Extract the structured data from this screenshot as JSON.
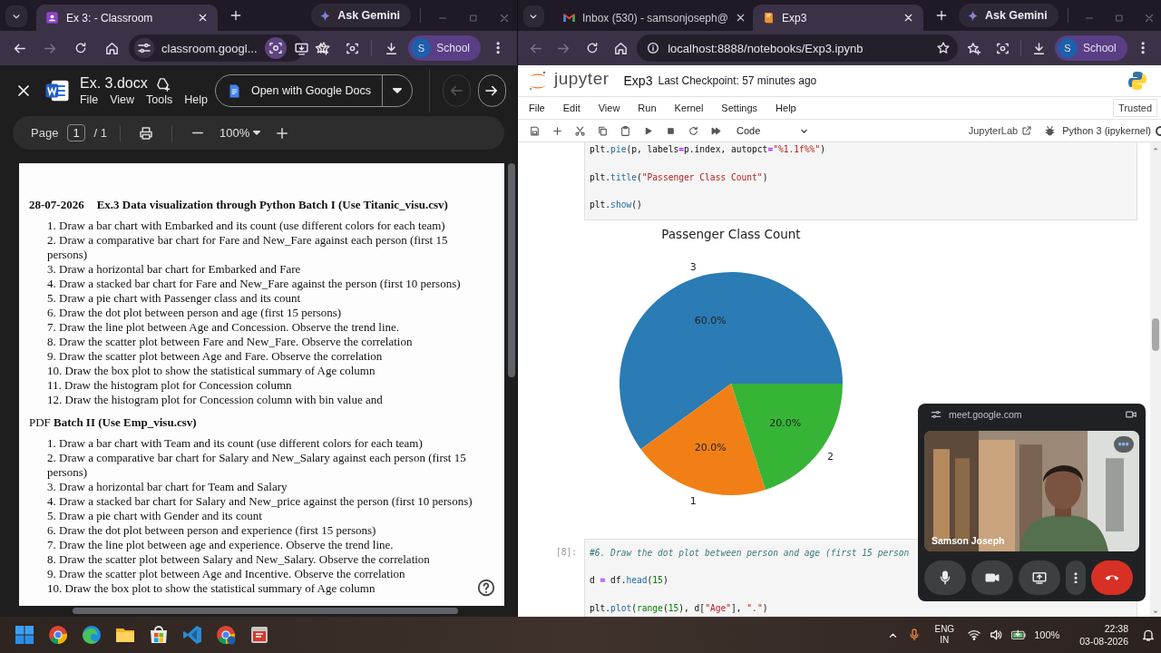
{
  "left_window": {
    "tabs": [
      {
        "kind": "classroom",
        "title": "Ex 3: - Classroom",
        "selected": true
      }
    ],
    "ask_gemini": "Ask Gemini",
    "url": "classroom.googl...",
    "profile": {
      "initial": "S",
      "label": "School"
    },
    "viewer": {
      "file_name": "Ex. 3.docx",
      "menu": [
        "File",
        "View",
        "Tools",
        "Help"
      ],
      "open_with": "Open with Google Docs",
      "page_label": "Page",
      "page": "1",
      "page_count": "/ 1",
      "zoom": "100%"
    },
    "document": {
      "sections": [
        {
          "bold": true,
          "heading": [
            "28-07-2026",
            "Ex.3 Data visualization through Python Batch I (Use Titanic_visu.csv)"
          ],
          "items": [
            "1. Draw a bar chart with Embarked and its count (use different colors for each team)",
            "2. Draw a comparative bar chart for Fare and New_Fare against each person (first 15 persons)",
            "3. Draw a horizontal bar chart for Embarked and Fare",
            "4. Draw a stacked bar chart for Fare and New_Fare against the person (first 10 persons)",
            "5. Draw a pie chart with Passenger class and its count",
            "6. Draw the dot plot between person and age (first 15 persons)",
            "7. Draw the line plot between Age and Concession. Observe the trend line.",
            "8. Draw the scatter plot between Fare and New_Fare. Observe the correlation",
            "9. Draw the scatter plot between Age and Fare. Observe the correlation",
            "10. Draw the box plot to show the statistical summary of Age column",
            "11. Draw the histogram plot for Concession column",
            "12. Draw the histogram plot for Concession column with bin value and"
          ]
        },
        {
          "bold": false,
          "heading": [
            "PDF **Batch II (Use Emp_visu.csv)**"
          ],
          "items": [
            "1. Draw a bar chart with Team and its count (use different colors for each team)",
            "2. Draw a comparative bar chart for Salary and New_Salary against each person (first 15 persons)",
            "3. Draw a horizontal bar chart for Team and Salary",
            "4. Draw a stacked bar chart for Salary and New_price against the person (first 10 persons)",
            "5. Draw a pie chart with Gender and its count",
            "6. Draw the dot plot between person and experience (first 15 persons)",
            "7. Draw the line plot between age and experience. Observe the trend line.",
            "8. Draw the scatter plot between Salary and New_Salary. Observe the correlation",
            "9. Draw the scatter plot between Age and Incentive. Observe the correlation",
            "10. Draw the box plot to show the statistical summary of Age column"
          ]
        }
      ]
    }
  },
  "right_window": {
    "tabs": [
      {
        "kind": "gmail",
        "title": "Inbox (530) - samsonjoseph@",
        "selected": false
      },
      {
        "kind": "jupyter",
        "title": "Exp3",
        "selected": true
      }
    ],
    "ask_gemini": "Ask Gemini",
    "url": "localhost:8888/notebooks/Exp3.ipynb",
    "profile": {
      "initial": "S",
      "label": "School"
    },
    "notebook": {
      "logo_text": "jupyter",
      "title": "Exp3",
      "checkpoint": "Last Checkpoint: 57 minutes ago",
      "menu": [
        "File",
        "Edit",
        "View",
        "Run",
        "Kernel",
        "Settings",
        "Help"
      ],
      "trust": "Trusted",
      "cell_type": "Code",
      "jupyterlab": "JupyterLab",
      "kernel": "Python 3 (ipykernel)",
      "cells": [
        {
          "kind": "code",
          "lines": [
            "plt.pie(p, labels=p.index, autopct=\"%1.1f%%\")",
            "plt.title(\"Passenger Class Count\")",
            "plt.show()"
          ]
        },
        {
          "kind": "output",
          "chart_data": {
            "type": "pie",
            "title": "Passenger Class Count",
            "categories": [
              "3",
              "1",
              "2"
            ],
            "values": [
              60,
              20,
              20
            ],
            "colors": [
              "#2b7bb4",
              "#f17f15",
              "#36b436"
            ],
            "value_labels": [
              "60.0%",
              "20.0%",
              "20.0%"
            ]
          }
        },
        {
          "kind": "code",
          "prompt": "[8]:",
          "lines": [
            "#6. Draw the dot plot between person and age (first 15 person",
            "d = df.head(15)",
            "plt.plot(range(15), d[\"Age\"], \".\")"
          ]
        }
      ]
    },
    "meet": {
      "site": "meet.google.com",
      "participant": "Samson Joseph"
    }
  },
  "taskbar": {
    "apps": [
      {
        "kind": "start"
      },
      {
        "kind": "chrome"
      },
      {
        "kind": "edge"
      },
      {
        "kind": "files"
      },
      {
        "kind": "store"
      },
      {
        "kind": "vscode"
      },
      {
        "kind": "chrome-profile"
      },
      {
        "kind": "app"
      }
    ],
    "language": "ENG",
    "region": "IN",
    "battery": "100%",
    "time": "22:38",
    "date": "03-08-2026"
  }
}
